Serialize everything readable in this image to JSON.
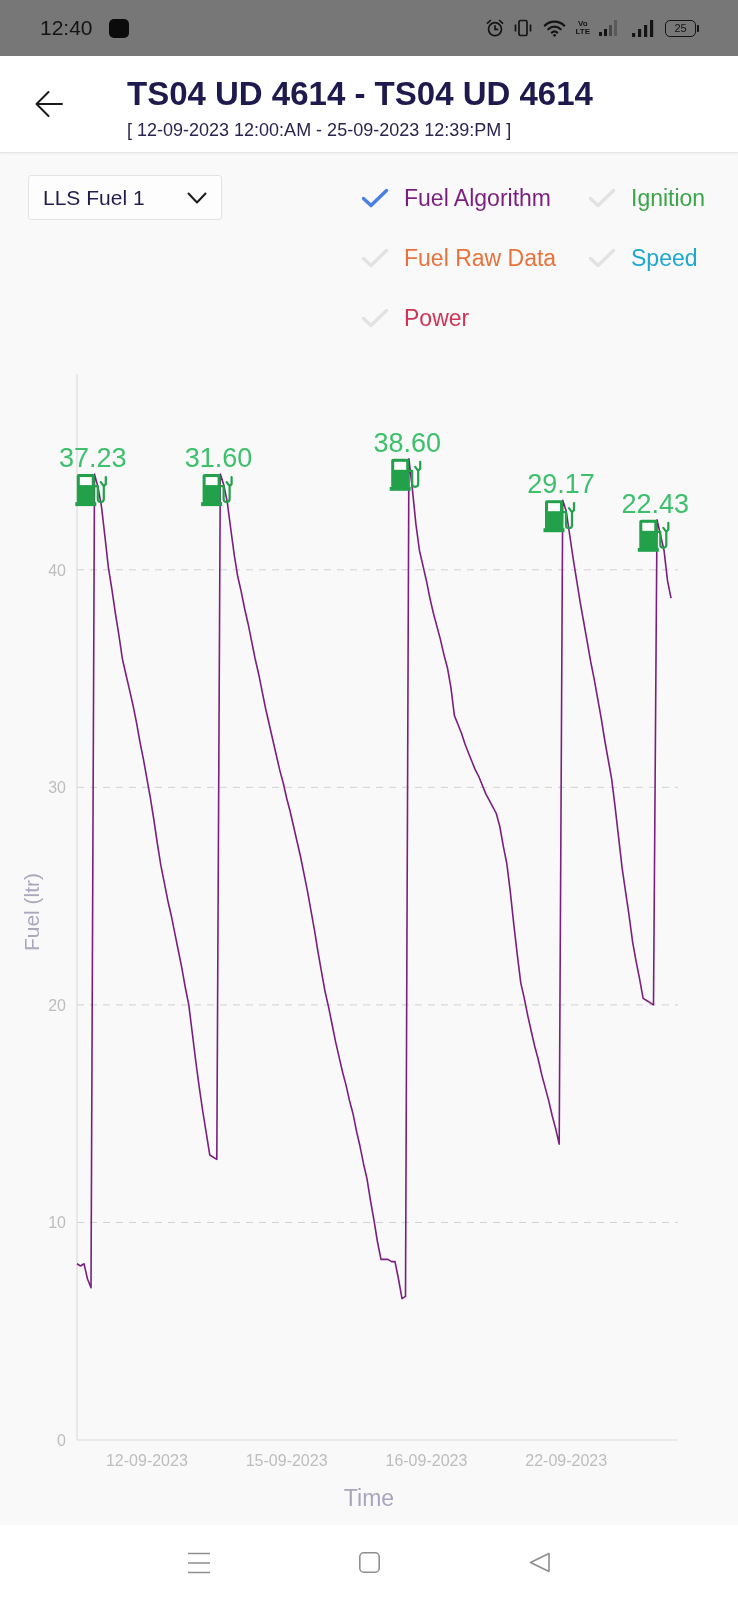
{
  "status_bar": {
    "time": "12:40",
    "network_type": "Vo LTE",
    "battery": "25"
  },
  "header": {
    "title": "TS04 UD 4614 - TS04 UD 4614",
    "subtitle": "[ 12-09-2023 12:00:AM - 25-09-2023 12:39:PM ]"
  },
  "sensor_dropdown": {
    "value": "LLS Fuel 1"
  },
  "series_toggles": [
    {
      "label": "Fuel Algorithm",
      "checked": true,
      "color": "#7b1f7e"
    },
    {
      "label": "Ignition",
      "checked": false,
      "color": "#3aa54a"
    },
    {
      "label": "Fuel Raw Data",
      "checked": false,
      "color": "#e8733a"
    },
    {
      "label": "Speed",
      "checked": false,
      "color": "#1ea7d0"
    },
    {
      "label": "Power",
      "checked": false,
      "color": "#cf3356"
    }
  ],
  "chart": {
    "chart_data": {
      "type": "line",
      "xlabel": "Time",
      "ylabel": "Fuel (ltr)",
      "grid": true,
      "ylim": [
        0,
        49
      ],
      "yticks": [
        0,
        10,
        20,
        30,
        40
      ],
      "categories": [
        null,
        null,
        null,
        null,
        null,
        null,
        null,
        null,
        null,
        null,
        null,
        null,
        null,
        null,
        null,
        null,
        null,
        null,
        null,
        null,
        "12-09-2023",
        null,
        null,
        null,
        null,
        null,
        null,
        null,
        null,
        null,
        null,
        null,
        null,
        null,
        null,
        null,
        null,
        null,
        null,
        null,
        null,
        null,
        null,
        null,
        null,
        null,
        null,
        null,
        null,
        null,
        null,
        null,
        null,
        null,
        null,
        null,
        null,
        null,
        null,
        null,
        "15-09-2023",
        null,
        null,
        null,
        null,
        null,
        null,
        null,
        null,
        null,
        null,
        null,
        null,
        null,
        null,
        null,
        null,
        null,
        null,
        null,
        null,
        null,
        null,
        null,
        null,
        null,
        null,
        null,
        null,
        null,
        null,
        null,
        null,
        null,
        null,
        null,
        null,
        null,
        null,
        null,
        "16-09-2023",
        null,
        null,
        null,
        null,
        null,
        null,
        null,
        null,
        null,
        null,
        null,
        null,
        null,
        null,
        null,
        null,
        null,
        null,
        null,
        null,
        null,
        null,
        null,
        null,
        null,
        null,
        null,
        null,
        null,
        null,
        null,
        null,
        null,
        null,
        null,
        null,
        null,
        null,
        null,
        "22-09-2023",
        null,
        null,
        null,
        null,
        null,
        null,
        null,
        null,
        null,
        null,
        null,
        null,
        null,
        null,
        null,
        null,
        null,
        null,
        null,
        null,
        null,
        null,
        null,
        null,
        null,
        null,
        null,
        null,
        null,
        null,
        null,
        null
      ],
      "series": [
        {
          "color": "#7b1f7e",
          "values": [
            8.1,
            8.0,
            8.1,
            7.4,
            7.0,
            44.4,
            43.8,
            42.9,
            41.5,
            40.1,
            39.1,
            38.0,
            37.0,
            35.9,
            35.2,
            34.5,
            33.8,
            33.0,
            32.1,
            31.3,
            30.4,
            29.5,
            28.5,
            27.4,
            26.4,
            25.6,
            24.8,
            24.1,
            23.3,
            22.5,
            21.7,
            20.8,
            20.0,
            18.7,
            17.4,
            16.2,
            15.1,
            14.1,
            13.1,
            13.0,
            12.9,
            44.4,
            43.9,
            43.1,
            41.9,
            40.7,
            39.7,
            39.0,
            38.2,
            37.5,
            36.7,
            35.9,
            35.2,
            34.4,
            33.6,
            32.9,
            32.2,
            31.5,
            30.8,
            30.2,
            29.5,
            28.9,
            28.2,
            27.5,
            26.8,
            26.0,
            25.2,
            24.3,
            23.4,
            22.4,
            21.5,
            20.6,
            19.9,
            19.1,
            18.3,
            17.6,
            16.9,
            16.3,
            15.6,
            15.0,
            14.2,
            13.5,
            12.7,
            12.0,
            11.0,
            10.1,
            9.1,
            8.3,
            8.3,
            8.3,
            8.2,
            8.2,
            7.4,
            6.5,
            6.6,
            45.1,
            43.7,
            42.1,
            40.9,
            40.2,
            39.5,
            38.7,
            38.0,
            37.4,
            36.8,
            36.1,
            35.5,
            34.6,
            33.3,
            32.9,
            32.5,
            32.0,
            31.6,
            31.2,
            30.8,
            30.5,
            30.1,
            29.7,
            29.4,
            29.1,
            28.8,
            28.2,
            27.3,
            26.5,
            25.2,
            23.7,
            22.3,
            21.0,
            20.3,
            19.5,
            18.8,
            18.1,
            17.5,
            16.8,
            16.2,
            15.6,
            14.9,
            14.3,
            13.6,
            43.2,
            42.7,
            41.6,
            40.5,
            39.5,
            38.5,
            37.6,
            36.7,
            35.8,
            35.0,
            34.1,
            33.2,
            32.2,
            31.3,
            30.4,
            29.1,
            27.7,
            26.3,
            25.2,
            24.1,
            22.9,
            22.0,
            21.2,
            20.3,
            20.2,
            20.1,
            20.0,
            42.3,
            41.6,
            40.9,
            39.5,
            38.7,
            null,
            null
          ]
        }
      ],
      "annotations": [
        {
          "y": 44.4,
          "text": "37.23"
        },
        {
          "y": 44.4,
          "text": "31.60"
        },
        {
          "y": 45.1,
          "text": "38.60"
        },
        {
          "y": 43.2,
          "text": "29.17"
        },
        {
          "y": 42.3,
          "text": "22.43"
        }
      ]
    }
  }
}
